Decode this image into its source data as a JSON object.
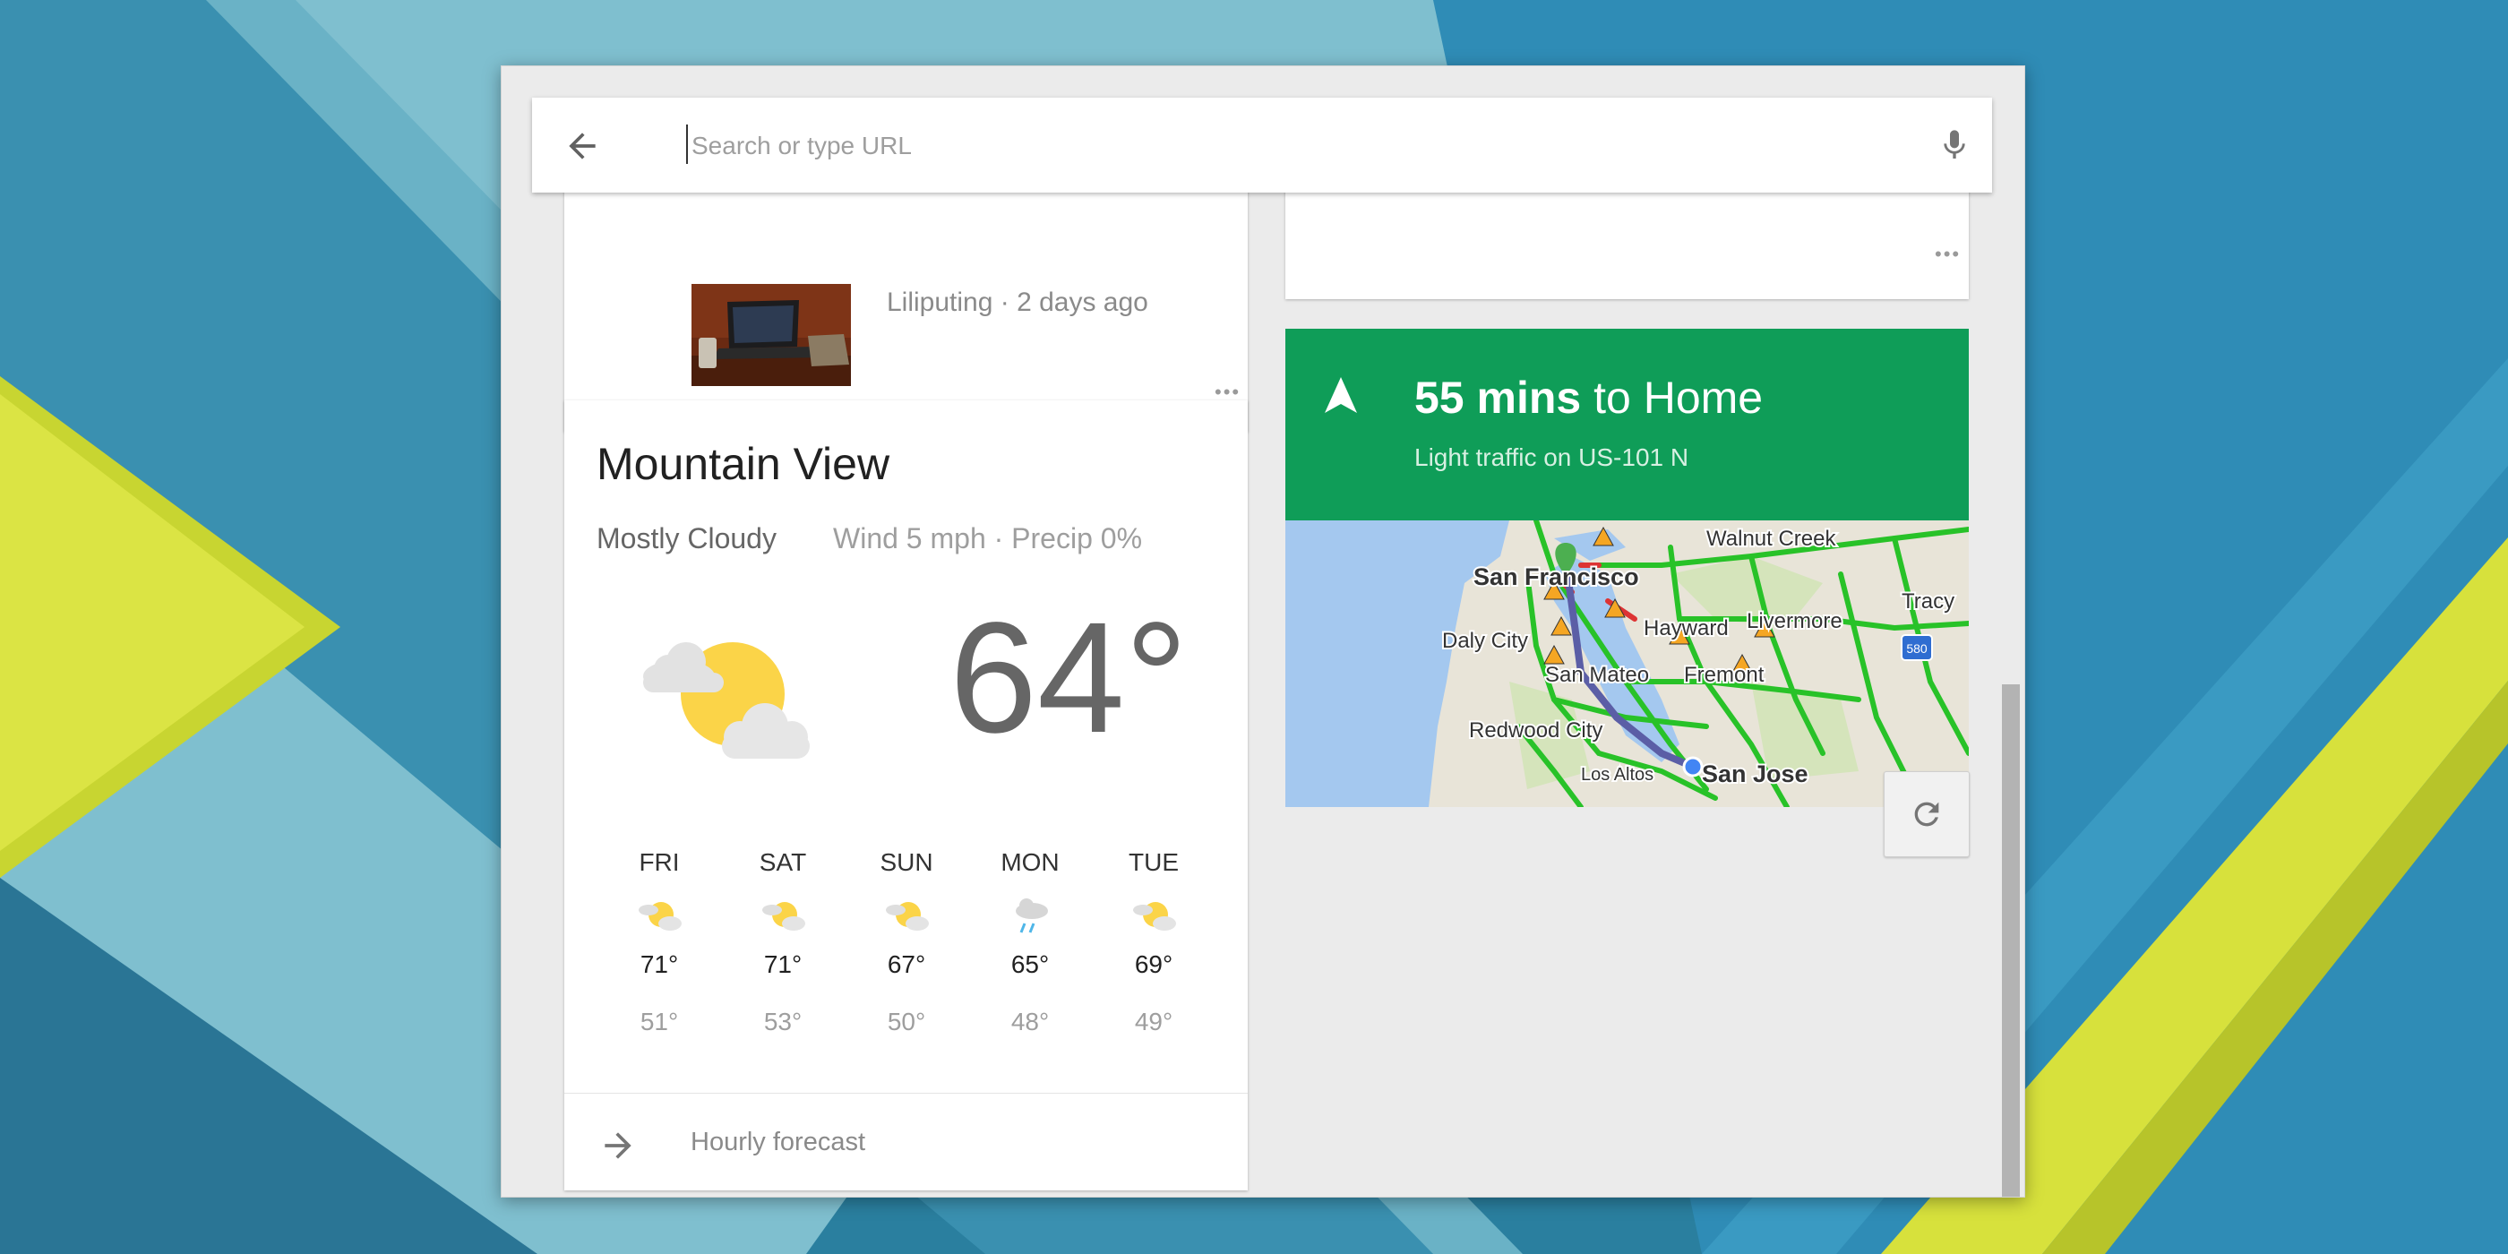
{
  "search": {
    "placeholder": "Search or type URL"
  },
  "news_card": {
    "meta": "Liliputing · 2 days ago"
  },
  "weather": {
    "city": "Mountain View",
    "condition": "Mostly Cloudy",
    "details": "Wind 5 mph · Precip 0%",
    "current_temp": "64°",
    "current_icon": "partly-cloudy-icon",
    "forecast": [
      {
        "day": "FRI",
        "high": "71°",
        "low": "51°",
        "icon": "partly-cloudy-icon"
      },
      {
        "day": "SAT",
        "high": "71°",
        "low": "53°",
        "icon": "partly-cloudy-icon"
      },
      {
        "day": "SUN",
        "high": "67°",
        "low": "50°",
        "icon": "partly-cloudy-icon"
      },
      {
        "day": "MON",
        "high": "65°",
        "low": "48°",
        "icon": "rain-icon"
      },
      {
        "day": "TUE",
        "high": "69°",
        "low": "49°",
        "icon": "partly-cloudy-icon"
      }
    ],
    "hourly_label": "Hourly forecast"
  },
  "traffic": {
    "duration": "55 mins",
    "destination": "to Home",
    "subtitle": "Light traffic on US-101 N",
    "header_color": "#0f9d58",
    "map_labels": {
      "walnut_creek": "Walnut Creek",
      "san_francisco": "San Francisco",
      "tracy": "Tracy",
      "daly_city": "Daly City",
      "hayward": "Hayward",
      "livermore": "Livermore",
      "san_mateo": "San Mateo",
      "fremont": "Fremont",
      "redwood_city": "Redwood City",
      "los_altos": "Los Altos",
      "san_jose": "San Jose",
      "highway_580": "580"
    }
  },
  "icons": {
    "back": "arrow-back-icon",
    "mic": "microphone-icon",
    "navigation": "navigation-arrow-icon",
    "refresh": "refresh-icon",
    "more": "more-dots-icon"
  }
}
